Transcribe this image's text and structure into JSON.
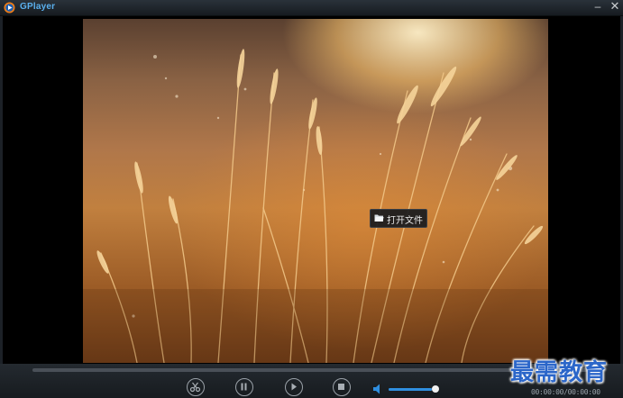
{
  "window": {
    "title": "GPlayer",
    "minimize_label": "–",
    "close_label": "✕",
    "logo_icon": "play-logo-icon",
    "accent_color": "#5ab0ee"
  },
  "video": {
    "open_file_label": "打开文件",
    "open_file_icon": "folder-open-icon"
  },
  "controls": {
    "buttons": [
      "cut-icon",
      "pause-icon",
      "play-icon",
      "stop-icon"
    ],
    "volume_icon": "speaker-icon",
    "volume_level_percent": 92,
    "volume_color": "#2f8fe0",
    "time": "00:00:00/00:00:00"
  },
  "watermark": {
    "text": "最需教育",
    "color": "#2b66c9"
  }
}
